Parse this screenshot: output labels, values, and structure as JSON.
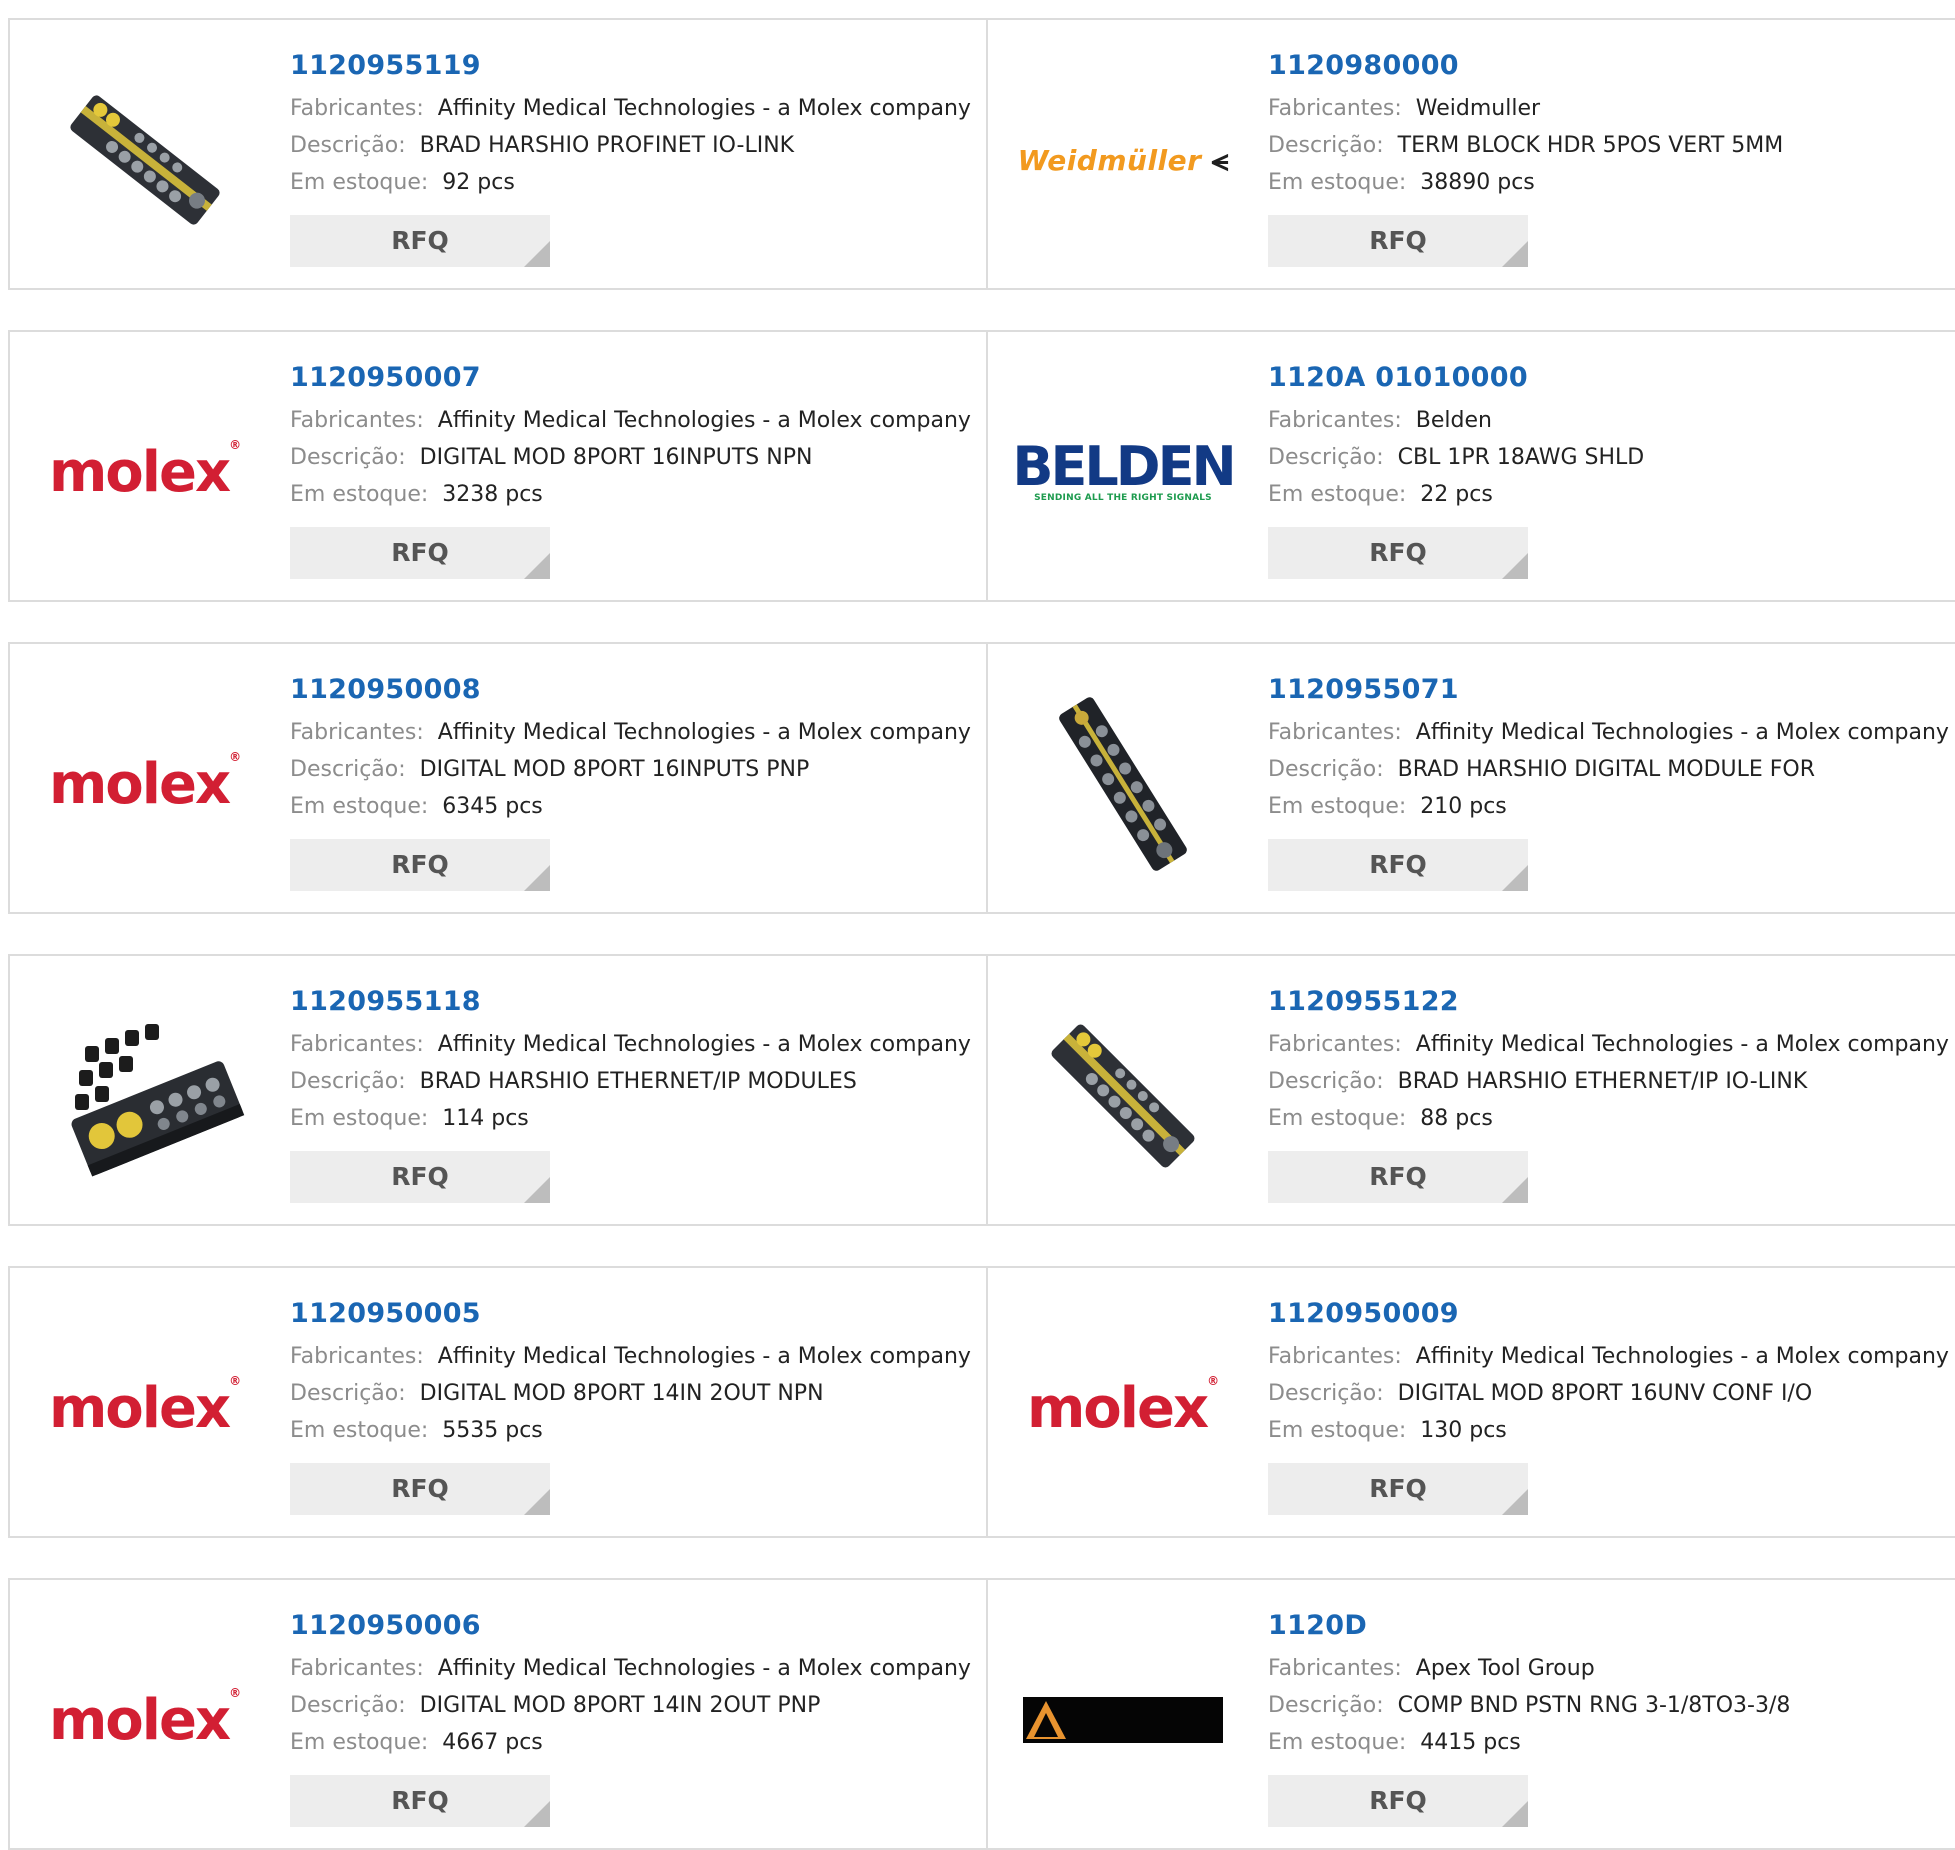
{
  "labels": {
    "manufacturer": "Fabricantes:",
    "description": "Descrição:",
    "stock": "Em estoque:",
    "rfq": "RFQ",
    "molex_logo": "molex",
    "molex_mark": "®",
    "weidmuller_logo": "Weidmüller",
    "weidmuller_mark": "⪪",
    "belden_logo": "BELDEN",
    "belden_tagline": "SENDING ALL THE RIGHT SIGNALS"
  },
  "products": [
    {
      "part": "1120955119",
      "manufacturer": "Affinity Medical Technologies - a Molex company",
      "description": "BRAD HARSHIO PROFINET IO-LINK",
      "stock": "92 pcs",
      "image": "io-module-diagonal"
    },
    {
      "part": "1120980000",
      "manufacturer": "Weidmuller",
      "description": "TERM BLOCK HDR 5POS VERT 5MM",
      "stock": "38890 pcs",
      "image": "weidmuller-logo"
    },
    {
      "part": "1120950007",
      "manufacturer": "Affinity Medical Technologies - a Molex company",
      "description": "DIGITAL MOD 8PORT 16INPUTS NPN",
      "stock": "3238 pcs",
      "image": "molex-logo"
    },
    {
      "part": "1120A 01010000",
      "manufacturer": "Belden",
      "description": "CBL 1PR 18AWG SHLD",
      "stock": "22 pcs",
      "image": "belden-logo"
    },
    {
      "part": "1120950008",
      "manufacturer": "Affinity Medical Technologies - a Molex company",
      "description": "DIGITAL MOD 8PORT 16INPUTS PNP",
      "stock": "6345 pcs",
      "image": "molex-logo"
    },
    {
      "part": "1120955071",
      "manufacturer": "Affinity Medical Technologies - a Molex company",
      "description": "BRAD HARSHIO DIGITAL MODULE FOR",
      "stock": "210 pcs",
      "image": "io-module-steep"
    },
    {
      "part": "1120955118",
      "manufacturer": "Affinity Medical Technologies - a Molex company",
      "description": "BRAD HARSHIO ETHERNET/IP MODULES",
      "stock": "114 pcs",
      "image": "io-module-caps"
    },
    {
      "part": "1120955122",
      "manufacturer": "Affinity Medical Technologies - a Molex company",
      "description": "BRAD HARSHIO ETHERNET/IP IO-LINK",
      "stock": "88 pcs",
      "image": "io-module-diagonal"
    },
    {
      "part": "1120950005",
      "manufacturer": "Affinity Medical Technologies - a Molex company",
      "description": "DIGITAL MOD 8PORT 14IN 2OUT NPN",
      "stock": "5535 pcs",
      "image": "molex-logo"
    },
    {
      "part": "1120950009",
      "manufacturer": "Affinity Medical Technologies - a Molex company",
      "description": "DIGITAL MOD 8PORT 16UNV CONF I/O",
      "stock": "130 pcs",
      "image": "molex-logo"
    },
    {
      "part": "1120950006",
      "manufacturer": "Affinity Medical Technologies - a Molex company",
      "description": "DIGITAL MOD 8PORT 14IN 2OUT PNP",
      "stock": "4667 pcs",
      "image": "molex-logo"
    },
    {
      "part": "1120D",
      "manufacturer": "Apex Tool Group",
      "description": "COMP BND PSTN RNG 3-1/8TO3-3/8",
      "stock": "4415 pcs",
      "image": "apex-logo"
    }
  ],
  "colors": {
    "link": "#1a66b3",
    "label": "#8c8c8c",
    "value": "#222222",
    "border": "#dcdcdc",
    "rfq_bg": "#ededed",
    "molex_red": "#d21f33",
    "weidmuller_orange": "#f29a1f",
    "belden_blue": "#123a85",
    "belden_green": "#1d9b4e"
  }
}
